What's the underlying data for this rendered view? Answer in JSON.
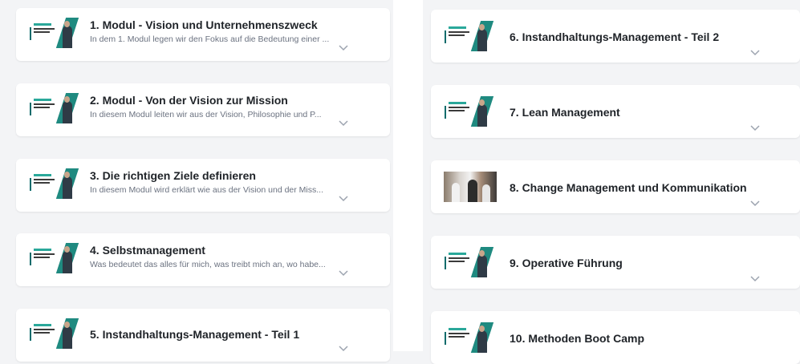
{
  "modules_left": [
    {
      "title": "1. Modul - Vision und Unternehmenszweck",
      "description": "In dem 1. Modul legen wir den Fokus auf die Bedeutung einer ...",
      "thumbnail_icon": "masterclass-thumbnail"
    },
    {
      "title": "2. Modul - Von der Vision zur Mission",
      "description": "In diesem Modul leiten wir aus der Vision, Philosophie und P...",
      "thumbnail_icon": "masterclass-thumbnail"
    },
    {
      "title": "3. Die richtigen Ziele definieren",
      "description": "In diesem Modul wird erklärt wie aus der Vision und der Miss...",
      "thumbnail_icon": "masterclass-thumbnail"
    },
    {
      "title": "4. Selbstmanagement",
      "description": "Was bedeutet das alles für mich, was treibt mich an, wo habe...",
      "thumbnail_icon": "masterclass-thumbnail"
    },
    {
      "title": "5. Instandhaltungs-Management - Teil 1",
      "description": "",
      "thumbnail_icon": "masterclass-thumbnail"
    }
  ],
  "modules_right": [
    {
      "title": "6. Instandhaltungs-Management - Teil 2",
      "thumbnail_icon": "masterclass-thumbnail"
    },
    {
      "title": "7. Lean Management",
      "thumbnail_icon": "masterclass-thumbnail"
    },
    {
      "title": "8. Change Management und Kommunikation",
      "thumbnail_icon": "team-photo-thumbnail"
    },
    {
      "title": "9. Operative Führung",
      "thumbnail_icon": "masterclass-thumbnail"
    },
    {
      "title": "10. Methoden Boot Camp",
      "thumbnail_icon": "masterclass-thumbnail"
    }
  ],
  "icons": {
    "expand": "chevron-down-icon"
  },
  "colors": {
    "accent_teal": "#1f8a80",
    "title_text": "#1f2328",
    "description_text": "#6b7280",
    "chevron": "#9ca3af"
  }
}
